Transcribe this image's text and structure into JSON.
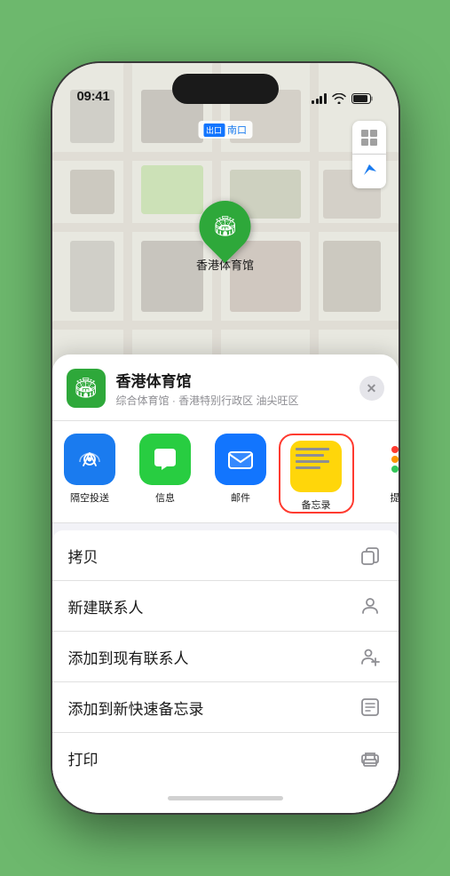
{
  "status_bar": {
    "time": "09:41",
    "location_arrow": "▶"
  },
  "map": {
    "label": "南口",
    "label_prefix": "出口",
    "controls": {
      "map_type": "⊞",
      "location": "↗"
    }
  },
  "pin": {
    "label": "香港体育馆"
  },
  "sheet": {
    "venue_name": "香港体育馆",
    "venue_subtitle": "综合体育馆 · 香港特别行政区 油尖旺区",
    "close_label": "×"
  },
  "share_items": [
    {
      "id": "airdrop",
      "label": "隔空投送",
      "icon_type": "airdrop"
    },
    {
      "id": "messages",
      "label": "信息",
      "icon_type": "messages"
    },
    {
      "id": "mail",
      "label": "邮件",
      "icon_type": "mail"
    },
    {
      "id": "notes",
      "label": "备忘录",
      "icon_type": "notes"
    },
    {
      "id": "more",
      "label": "提",
      "icon_type": "more"
    }
  ],
  "actions": [
    {
      "id": "copy",
      "label": "拷贝",
      "icon": "copy"
    },
    {
      "id": "new-contact",
      "label": "新建联系人",
      "icon": "person"
    },
    {
      "id": "add-contact",
      "label": "添加到现有联系人",
      "icon": "person-add"
    },
    {
      "id": "quick-note",
      "label": "添加到新快速备忘录",
      "icon": "note"
    },
    {
      "id": "print",
      "label": "打印",
      "icon": "print"
    }
  ]
}
